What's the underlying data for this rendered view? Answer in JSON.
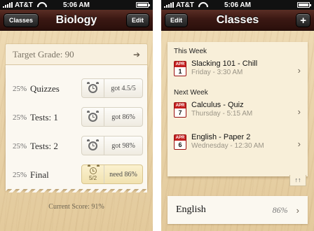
{
  "status": {
    "carrier": "AT&T",
    "time": "5:06 AM"
  },
  "biology": {
    "back_label": "Classes",
    "title": "Biology",
    "edit_label": "Edit",
    "target": "Target Grade: 90",
    "categories": [
      {
        "pct": "25%",
        "name": "Quizzes",
        "score": "got 4.5/5",
        "ratio": ""
      },
      {
        "pct": "25%",
        "name": "Tests: 1",
        "score": "got 86%",
        "ratio": ""
      },
      {
        "pct": "25%",
        "name": "Tests: 2",
        "score": "got 98%",
        "ratio": ""
      },
      {
        "pct": "25%",
        "name": "Final",
        "score": "need 86%",
        "ratio": "5/2"
      }
    ],
    "current_score": "Current Score: 91%"
  },
  "classes": {
    "edit_label": "Edit",
    "title": "Classes",
    "add_label": "+",
    "this_week": "This Week",
    "next_week": "Next Week",
    "events_this_week": [
      {
        "month": "APR",
        "day": "1",
        "title": "Slacking 101 - Chill",
        "time": "Friday - 3:30 AM"
      }
    ],
    "events_next_week": [
      {
        "month": "APR",
        "day": "7",
        "title": "Calculus - Quiz",
        "time": "Thursday - 5:15 AM"
      },
      {
        "month": "APR",
        "day": "6",
        "title": "English - Paper 2",
        "time": "Wednesday - 12:30 AM"
      }
    ],
    "sort_label": "↑↑",
    "class_list": [
      {
        "name": "English",
        "score": "86%"
      }
    ]
  },
  "icons": [
    "signal-icon",
    "wifi-icon",
    "battery-icon",
    "arrow-icon",
    "alarm-icon",
    "chevron-right-icon",
    "calendar-icon",
    "plus-icon",
    "sort-icon"
  ]
}
